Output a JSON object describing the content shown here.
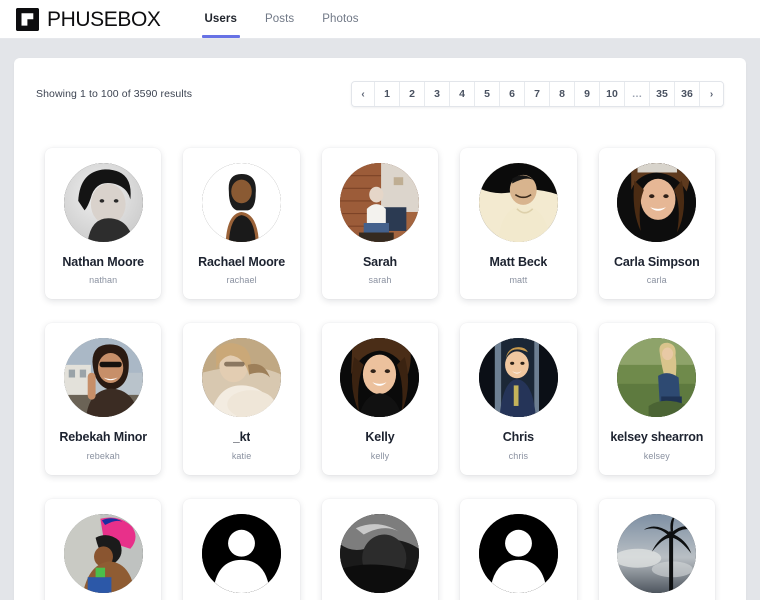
{
  "header": {
    "brand_name": "PHUSEBOX",
    "brand_icon": "phusebox-flag-logo",
    "nav": [
      {
        "label": "Users",
        "active": true
      },
      {
        "label": "Posts",
        "active": false
      },
      {
        "label": "Photos",
        "active": false
      }
    ]
  },
  "accent_color": "#6772e5",
  "page_background": "#e3e5e9",
  "panel_background": "#ffffff",
  "results": {
    "summary": "Showing 1 to 100 of 3590 results",
    "from": 1,
    "to": 100,
    "total": 3590
  },
  "pagination": {
    "prev_icon": "‹",
    "next_icon": "›",
    "gap_label": "…",
    "pages": [
      "1",
      "2",
      "3",
      "4",
      "5",
      "6",
      "7",
      "8",
      "9",
      "10",
      "…",
      "35",
      "36"
    ],
    "current_page": 1
  },
  "users": [
    {
      "name": "Nathan Moore",
      "handle": "nathan",
      "avatar": "photo-portrait-bw-man",
      "avatar_type": "photo"
    },
    {
      "name": "Rachael Moore",
      "handle": "rachael",
      "avatar": "illustration-avatar-woman",
      "avatar_type": "photo"
    },
    {
      "name": "Sarah",
      "handle": "sarah",
      "avatar": "photo-brick-wall-seated",
      "avatar_type": "photo"
    },
    {
      "name": "Matt Beck",
      "handle": "matt",
      "avatar": "photo-man-cream-sweater",
      "avatar_type": "photo"
    },
    {
      "name": "Carla Simpson",
      "handle": "carla",
      "avatar": "photo-smiling-woman",
      "avatar_type": "photo"
    },
    {
      "name": "Rebekah Minor",
      "handle": "rebekah",
      "avatar": "photo-woman-sunglasses-street",
      "avatar_type": "photo"
    },
    {
      "name": "_kt",
      "handle": "katie",
      "avatar": "photo-sepia-woman-glasses",
      "avatar_type": "photo"
    },
    {
      "name": "Kelly",
      "handle": "kelly",
      "avatar": "photo-woman-brown-hair",
      "avatar_type": "photo"
    },
    {
      "name": "Chris",
      "handle": "chris",
      "avatar": "photo-toddler-doorway",
      "avatar_type": "photo"
    },
    {
      "name": "kelsey shearron",
      "handle": "kelsey",
      "avatar": "photo-woman-field",
      "avatar_type": "photo"
    },
    {
      "name": "",
      "handle": "",
      "avatar": "photo-colorful-outdoor",
      "avatar_type": "photo"
    },
    {
      "name": "",
      "handle": "",
      "avatar": "default-user-silhouette",
      "avatar_type": "placeholder"
    },
    {
      "name": "",
      "handle": "",
      "avatar": "photo-dark-grayscale",
      "avatar_type": "photo"
    },
    {
      "name": "",
      "handle": "",
      "avatar": "default-user-silhouette",
      "avatar_type": "placeholder"
    },
    {
      "name": "",
      "handle": "",
      "avatar": "photo-palm-tree-sky",
      "avatar_type": "photo"
    }
  ]
}
